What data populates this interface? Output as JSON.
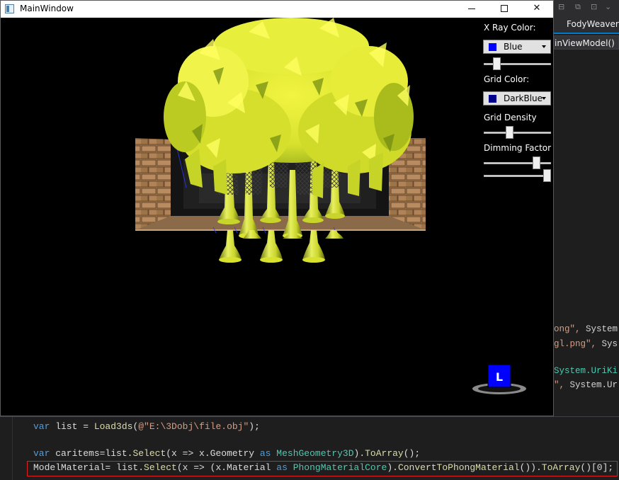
{
  "window": {
    "title": "MainWindow",
    "controls": {
      "minimize": "—",
      "maximize": "☐",
      "close": "✕"
    }
  },
  "panel": {
    "xray_label": "X Ray Color:",
    "xray_value": "Blue",
    "xray_color": "#0000ff",
    "xray_slider": 0.16,
    "grid_label": "Grid Color:",
    "grid_value": "DarkBlue",
    "grid_color": "#00008b",
    "grid_density_label": "Grid Density",
    "grid_density": 0.37,
    "dimming_label": "Dimming Factor",
    "dimming": 0.82,
    "extra_slider": 1.0
  },
  "navcube": {
    "letter": "L",
    "color": "#0000ff"
  },
  "ide": {
    "tab_label": "FodyWeavers",
    "nav_text": "inViewModel()",
    "right_lines": [
      {
        "a": "ong\",",
        "b": " System"
      },
      {
        "a": "gl.png\",",
        "b": " Sys"
      },
      {
        "a": "",
        "b": "System.UriKi"
      },
      {
        "a": "\",",
        "b": " System.Ur"
      }
    ],
    "bottom_lines": [
      "var list = Load3ds(@\"E:\\3Dobj\\file.obj\");",
      "var caritems=list.Select(x => x.Geometry as MeshGeometry3D).ToArray();",
      "ModelMaterial= list.Select(x => (x.Material as PhongMaterialCore).ConvertToPhongMaterial()).ToArray()[0];"
    ]
  }
}
